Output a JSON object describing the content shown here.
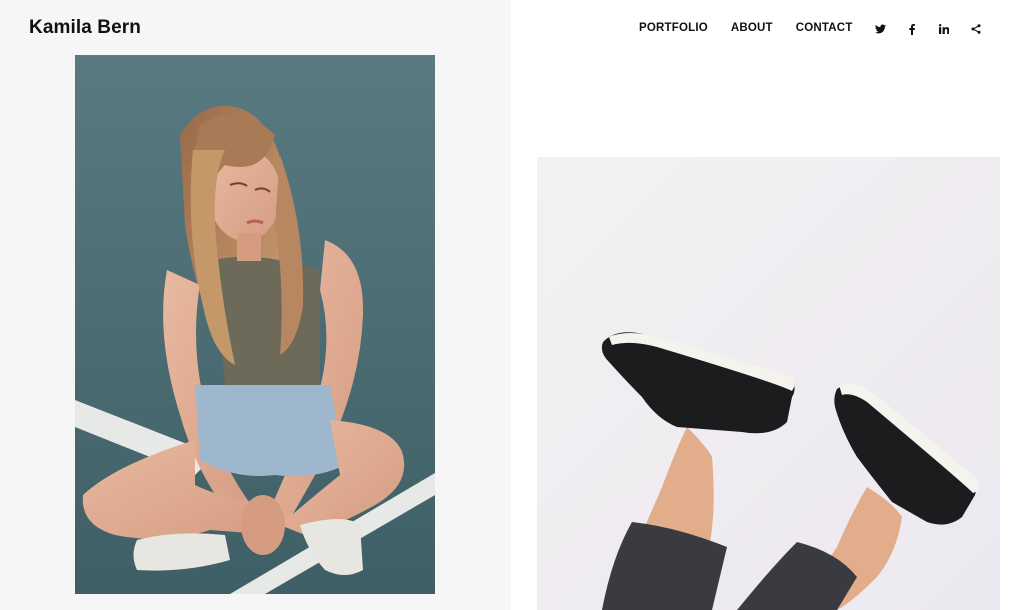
{
  "site": {
    "title": "Kamila Bern"
  },
  "nav": {
    "items": [
      {
        "label": "PORTFOLIO"
      },
      {
        "label": "ABOUT"
      },
      {
        "label": "CONTACT"
      }
    ]
  },
  "social": {
    "icons": [
      "twitter-icon",
      "facebook-icon",
      "linkedin-icon",
      "share-icon"
    ]
  },
  "gallery": {
    "images": [
      {
        "name": "portfolio-photo-girl-sitting"
      },
      {
        "name": "portfolio-photo-sneakers"
      }
    ]
  },
  "colors": {
    "left_background": "#f6f6f7",
    "right_background": "#ffffff",
    "text": "#111111"
  }
}
